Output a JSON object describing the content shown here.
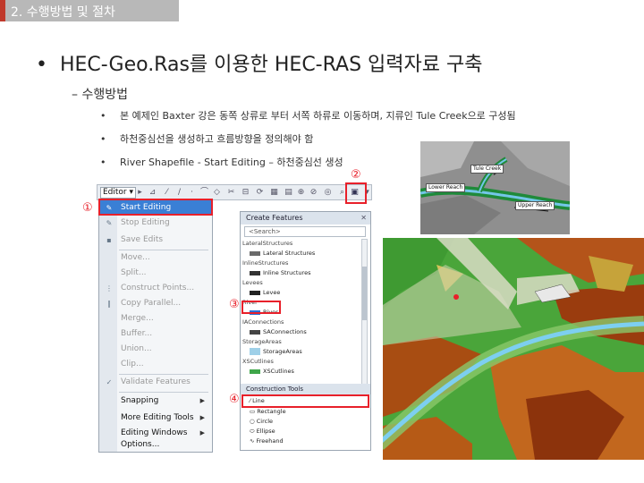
{
  "slide": {
    "section_title": "2. 수행방법 및 절차",
    "main_heading": "HEC-Geo.Ras를 이용한 HEC-RAS 입력자료 구축",
    "sub_heading": "– 수행방법",
    "bullets": [
      "본 예제인 Baxter 강은 동쪽 상류로 부터 서쪽 하류로 이동하며, 지류인 Tule Creek으로 구성됨",
      "하천중심선을 생성하고 흐름방향을 정의해야 함",
      "River Shapefile - Start Editing – 하천중심선 생성"
    ],
    "markers": [
      "①",
      "②",
      "③",
      "④"
    ]
  },
  "editor": {
    "toolbar_label": "Editor ▾",
    "menu_items": [
      {
        "label": "Start Editing",
        "state": "active"
      },
      {
        "label": "Stop Editing",
        "state": "disabled"
      },
      {
        "label": "Save Edits",
        "state": "disabled"
      },
      {
        "label": "Move...",
        "state": "disabled"
      },
      {
        "label": "Split...",
        "state": "disabled"
      },
      {
        "label": "Construct Points...",
        "state": "disabled"
      },
      {
        "label": "Copy Parallel...",
        "state": "disabled"
      },
      {
        "label": "Merge...",
        "state": "disabled"
      },
      {
        "label": "Buffer...",
        "state": "disabled"
      },
      {
        "label": "Union...",
        "state": "disabled"
      },
      {
        "label": "Clip...",
        "state": "disabled"
      },
      {
        "label": "Validate Features",
        "state": "disabled"
      },
      {
        "label": "Snapping",
        "state": "enabled"
      },
      {
        "label": "More Editing Tools",
        "state": "enabled"
      },
      {
        "label": "Editing Windows",
        "state": "enabled"
      },
      {
        "label": "Options...",
        "state": "enabled"
      }
    ]
  },
  "create_features": {
    "title": "Create Features",
    "search_placeholder": "<Search>",
    "rows": [
      {
        "label": "LateralStructures",
        "kind": "group"
      },
      {
        "label": "Lateral Structures",
        "kind": "item",
        "swatch": "#6a6a6a"
      },
      {
        "label": "InlineStructures",
        "kind": "group"
      },
      {
        "label": "Inline Structures",
        "kind": "item",
        "swatch": "#333333"
      },
      {
        "label": "Levees",
        "kind": "group"
      },
      {
        "label": "Levee",
        "kind": "item",
        "swatch": "#222222"
      },
      {
        "label": "River",
        "kind": "group"
      },
      {
        "label": "River",
        "kind": "item",
        "swatch": "#2a6fd6"
      },
      {
        "label": "IAConnections",
        "kind": "group"
      },
      {
        "label": "SAConnections",
        "kind": "item",
        "swatch": "#444444"
      },
      {
        "label": "StorageAreas",
        "kind": "group"
      },
      {
        "label": "StorageAreas",
        "kind": "item",
        "swatch": "#9fd0e8"
      },
      {
        "label": "XSCutlines",
        "kind": "group"
      },
      {
        "label": "XSCutlines",
        "kind": "item",
        "swatch": "#3fa64a"
      }
    ],
    "construction_title": "Construction Tools",
    "construction_tools": [
      "Line",
      "Rectangle",
      "Circle",
      "Ellipse",
      "Freehand"
    ]
  },
  "map": {
    "inset_labels": [
      "Tule Creek",
      "Lower Reach",
      "Upper Reach"
    ]
  },
  "colors": {
    "accent_red": "#e8202a",
    "menu_highlight": "#3a7fd5",
    "header_bar": "#b8b8b8",
    "header_accent": "#c0392b"
  },
  "icons": [
    "editor-pencil-icon",
    "create-features-icon",
    "sketch-line-icon",
    "arrow-pointer-icon"
  ]
}
